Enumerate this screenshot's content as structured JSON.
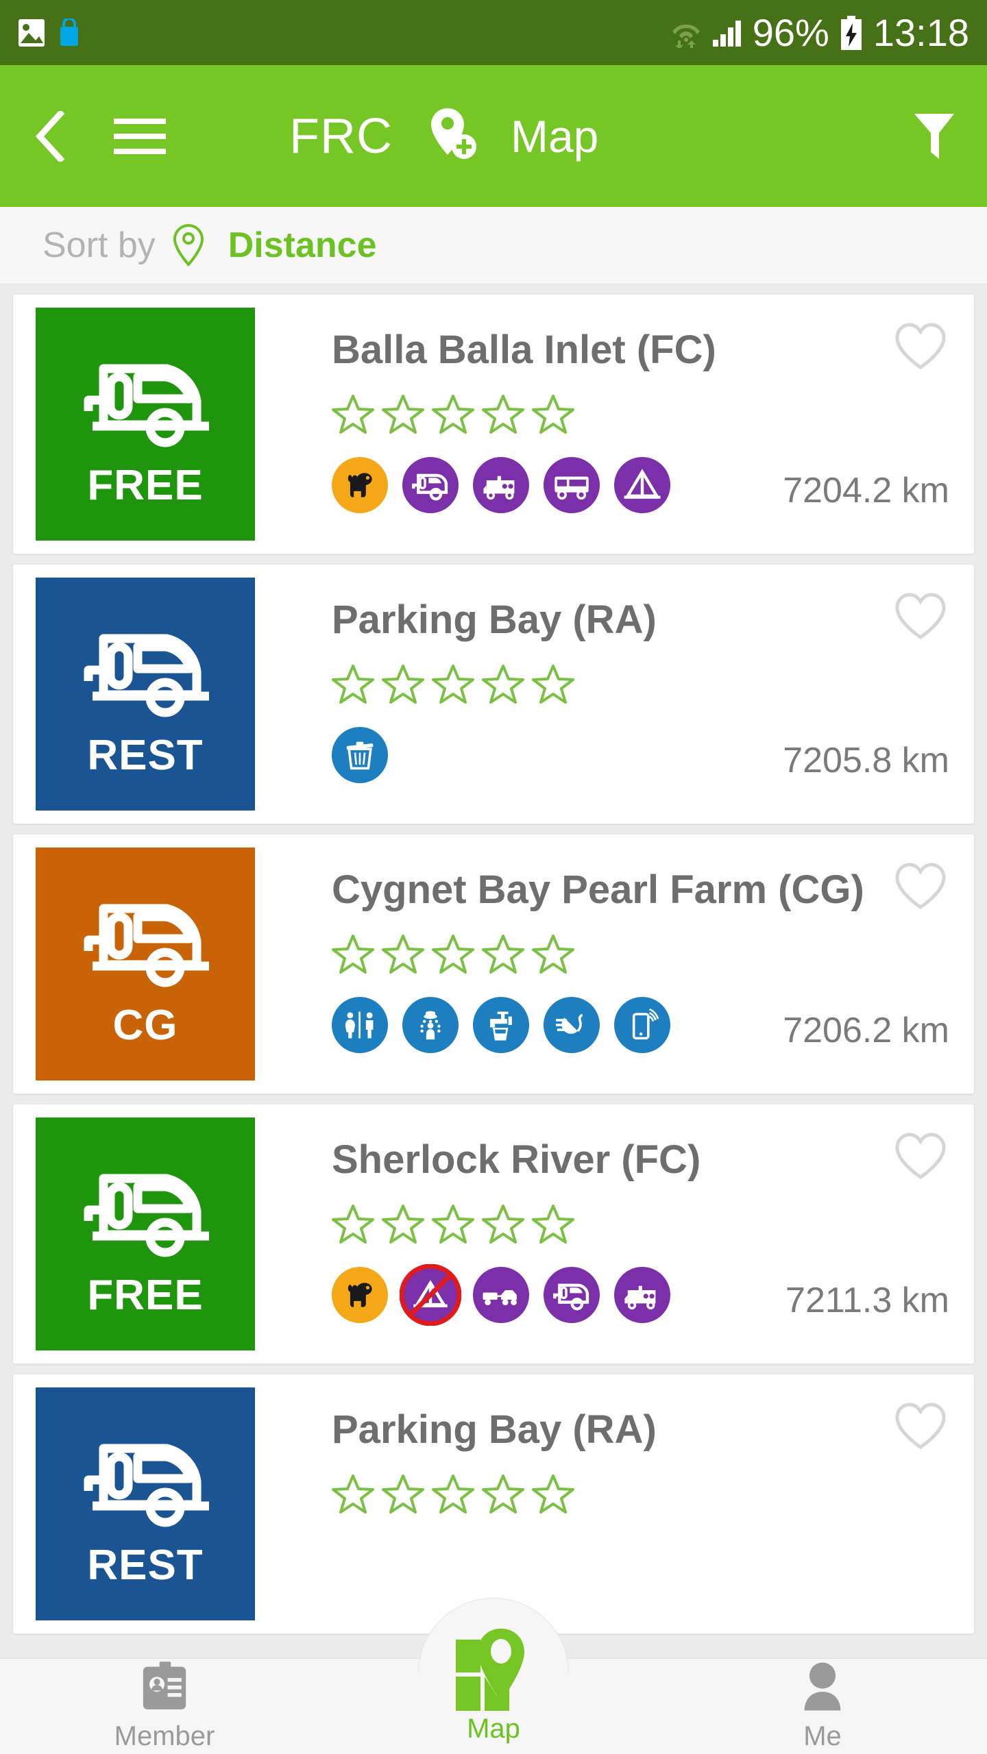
{
  "status_bar": {
    "battery_percent": "96%",
    "time": "13:18",
    "icons": [
      "photos-icon",
      "shopping-bag-icon",
      "wifi-icon",
      "signal-icon",
      "battery-charging-icon"
    ],
    "background": "#477117"
  },
  "app_bar": {
    "title": "FRC",
    "map_label": "Map",
    "background": "#76c626",
    "icons": [
      "back-icon",
      "hamburger-menu-icon",
      "add-location-pin-icon",
      "filter-funnel-icon"
    ]
  },
  "sort_bar": {
    "label": "Sort by",
    "value": "Distance",
    "icon": "location-pin-icon",
    "value_color": "#6cc223"
  },
  "listings": [
    {
      "title": "Balla Balla Inlet (FC)",
      "badge": "FREE",
      "badge_color": "#1f950d",
      "rating": 0,
      "max_rating": 5,
      "distance": "7204.2 km",
      "favorite": false,
      "amenities": [
        {
          "name": "dog-allowed-icon",
          "color": "#f5a817"
        },
        {
          "name": "caravan-icon",
          "color": "#7b2fa8"
        },
        {
          "name": "motorhome-icon",
          "color": "#7b2fa8"
        },
        {
          "name": "bus-icon",
          "color": "#7b2fa8"
        },
        {
          "name": "tent-icon",
          "color": "#7b2fa8"
        }
      ]
    },
    {
      "title": "Parking Bay (RA)",
      "badge": "REST",
      "badge_color": "#1b5493",
      "rating": 0,
      "max_rating": 5,
      "distance": "7205.8 km",
      "favorite": false,
      "amenities": [
        {
          "name": "rubbish-bin-icon",
          "color": "#1d7ec0"
        }
      ]
    },
    {
      "title": "Cygnet Bay Pearl Farm (CG)",
      "badge": "CG",
      "badge_color": "#c96307",
      "rating": 0,
      "max_rating": 5,
      "distance": "7206.2 km",
      "favorite": false,
      "amenities": [
        {
          "name": "toilets-icon",
          "color": "#1d7ec0"
        },
        {
          "name": "shower-icon",
          "color": "#1d7ec0"
        },
        {
          "name": "drinking-water-icon",
          "color": "#1d7ec0"
        },
        {
          "name": "power-plug-icon",
          "color": "#1d7ec0"
        },
        {
          "name": "mobile-signal-icon",
          "color": "#1d7ec0"
        }
      ]
    },
    {
      "title": "Sherlock River (FC)",
      "badge": "FREE",
      "badge_color": "#1f950d",
      "rating": 0,
      "max_rating": 5,
      "distance": "7211.3 km",
      "favorite": false,
      "amenities": [
        {
          "name": "dog-allowed-icon",
          "color": "#f5a817"
        },
        {
          "name": "no-tent-icon",
          "color": "#7b2fa8"
        },
        {
          "name": "car-trailer-icon",
          "color": "#7b2fa8"
        },
        {
          "name": "caravan-icon",
          "color": "#7b2fa8"
        },
        {
          "name": "motorhome-icon",
          "color": "#7b2fa8"
        }
      ]
    },
    {
      "title": "Parking Bay (RA)",
      "badge": "REST",
      "badge_color": "#1b5493",
      "rating": 0,
      "max_rating": 5,
      "distance": "",
      "favorite": false,
      "amenities": []
    }
  ],
  "bottom_nav": {
    "items": [
      {
        "label": "Member",
        "icon": "member-card-icon",
        "active": false
      },
      {
        "label": "Map",
        "icon": "map-pin-logo-icon",
        "active": true
      },
      {
        "label": "Me",
        "icon": "person-icon",
        "active": false
      }
    ]
  }
}
